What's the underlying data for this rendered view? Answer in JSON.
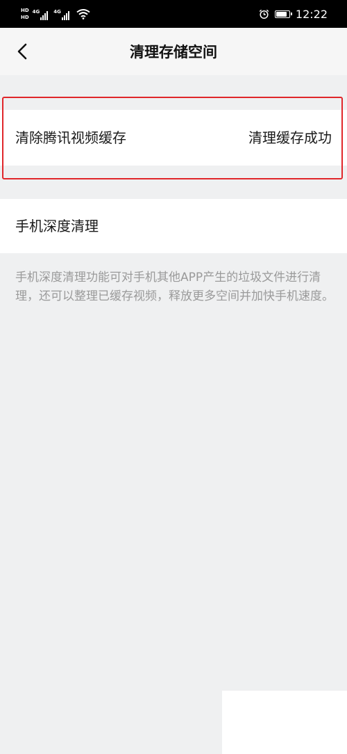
{
  "status_bar": {
    "hd_1": "HD",
    "hd_2": "HD",
    "network_1": "4G",
    "network_2": "4G",
    "time": "12:22",
    "battery_level": 0.85,
    "icons": [
      "hd-icon",
      "signal-icon",
      "wifi-icon",
      "alarm-icon",
      "battery-icon"
    ]
  },
  "header": {
    "title": "清理存储空间",
    "back_icon": "chevron-left-icon"
  },
  "cache_row": {
    "label": "清除腾讯视频缓存",
    "status": "清理缓存成功"
  },
  "deep_clean_row": {
    "label": "手机深度清理"
  },
  "description": "手机深度清理功能可对手机其他APP产生的垃圾文件进行清理，还可以整理已缓存视频，释放更多空间并加快手机速度。",
  "colors": {
    "background": "#eff0f1",
    "row_background": "#ffffff",
    "highlight": "#e0262a",
    "description_text": "#9a9a9a"
  }
}
